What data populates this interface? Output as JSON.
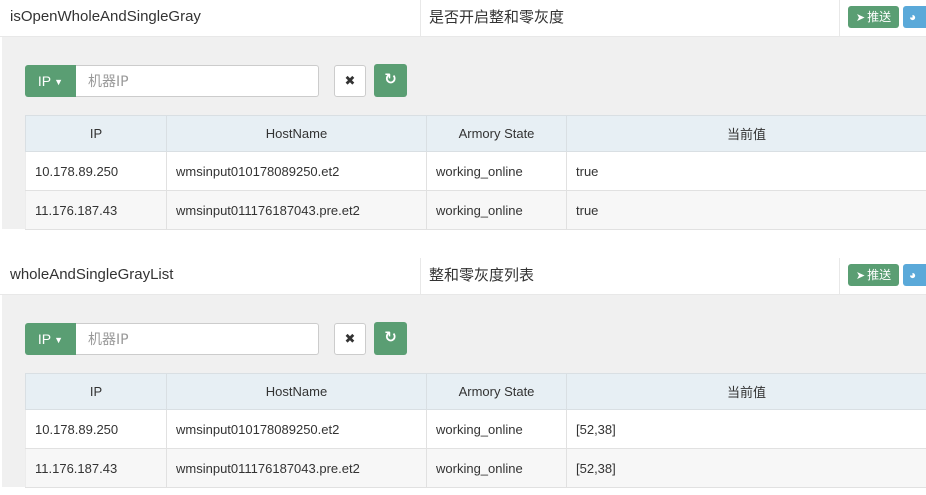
{
  "sections": [
    {
      "key": "isOpenWholeAndSingleGray",
      "description": "是否开启整和零灰度",
      "push_label": "推送",
      "ip_dropdown_label": "IP",
      "ip_placeholder": "机器IP",
      "columns": [
        "IP",
        "HostName",
        "Armory State",
        "当前值"
      ],
      "rows": [
        {
          "ip": "10.178.89.250",
          "host": "wmsinput010178089250.et2",
          "state": "working_online",
          "value": "true"
        },
        {
          "ip": "11.176.187.43",
          "host": "wmsinput011176187043.pre.et2",
          "state": "working_online",
          "value": "true"
        }
      ]
    },
    {
      "key": "wholeAndSingleGrayList",
      "description": "整和零灰度列表",
      "push_label": "推送",
      "ip_dropdown_label": "IP",
      "ip_placeholder": "机器IP",
      "columns": [
        "IP",
        "HostName",
        "Armory State",
        "当前值"
      ],
      "rows": [
        {
          "ip": "10.178.89.250",
          "host": "wmsinput010178089250.et2",
          "state": "working_online",
          "value": "[52,38]"
        },
        {
          "ip": "11.176.187.43",
          "host": "wmsinput011176187043.pre.et2",
          "state": "working_online",
          "value": "[52,38]"
        }
      ]
    }
  ],
  "icons": {
    "push": "paper-plane-icon",
    "chart": "pie-chart-icon",
    "clear": "times-icon",
    "refresh": "refresh-icon",
    "caret": "caret-down-icon"
  },
  "colors": {
    "green": "#5a9e73",
    "blue": "#5aa9d9",
    "header_bg": "#e7eff4",
    "panel_bg": "#f0f0f0"
  }
}
